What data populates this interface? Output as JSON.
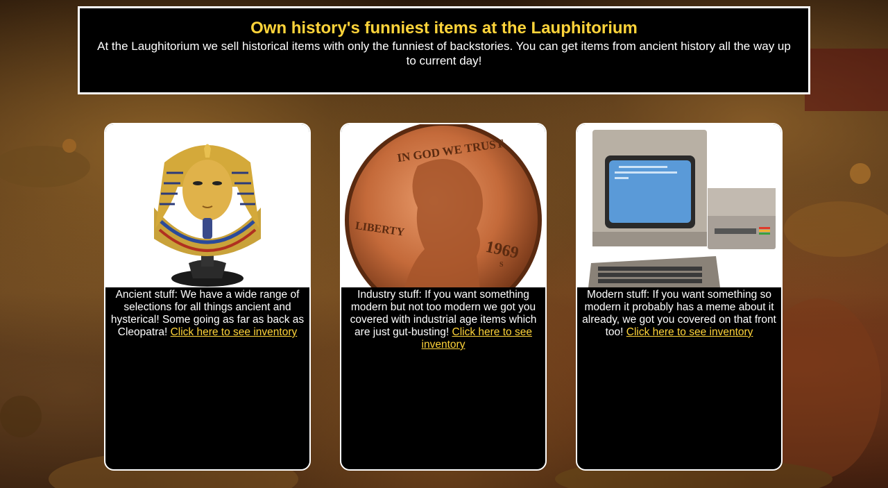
{
  "header": {
    "title": "Own history's funniest items at the Lauphitorium",
    "description": "At the Laughitorium we sell historical items with only the funniest of backstories. You can get items from ancient history all the way up to current day!"
  },
  "cards": [
    {
      "image": "pharaoh-mask-bust",
      "text": "Ancient stuff: We have a wide range of selections for all things ancient and hysterical! Some going as far as back as Cleopatra!",
      "link": "Click here to see inventory"
    },
    {
      "image": "1969-penny-coin",
      "text": "Industry stuff: If you want something modern but not too modern we got you covered with industrial age items which are just gut-busting!",
      "link": "Click here to see inventory"
    },
    {
      "image": "retro-computer",
      "text": "Modern stuff: If you want something so modern it probably has a meme about it already, we got you covered on that front too!",
      "link": "Click here to see inventory"
    }
  ],
  "coin": {
    "motto": "IN GOD WE TRUST",
    "liberty": "LIBERTY",
    "year": "1969",
    "mint": "S"
  },
  "colors": {
    "accent": "#ffd43a",
    "panel": "#000000",
    "border": "#ffffff"
  }
}
